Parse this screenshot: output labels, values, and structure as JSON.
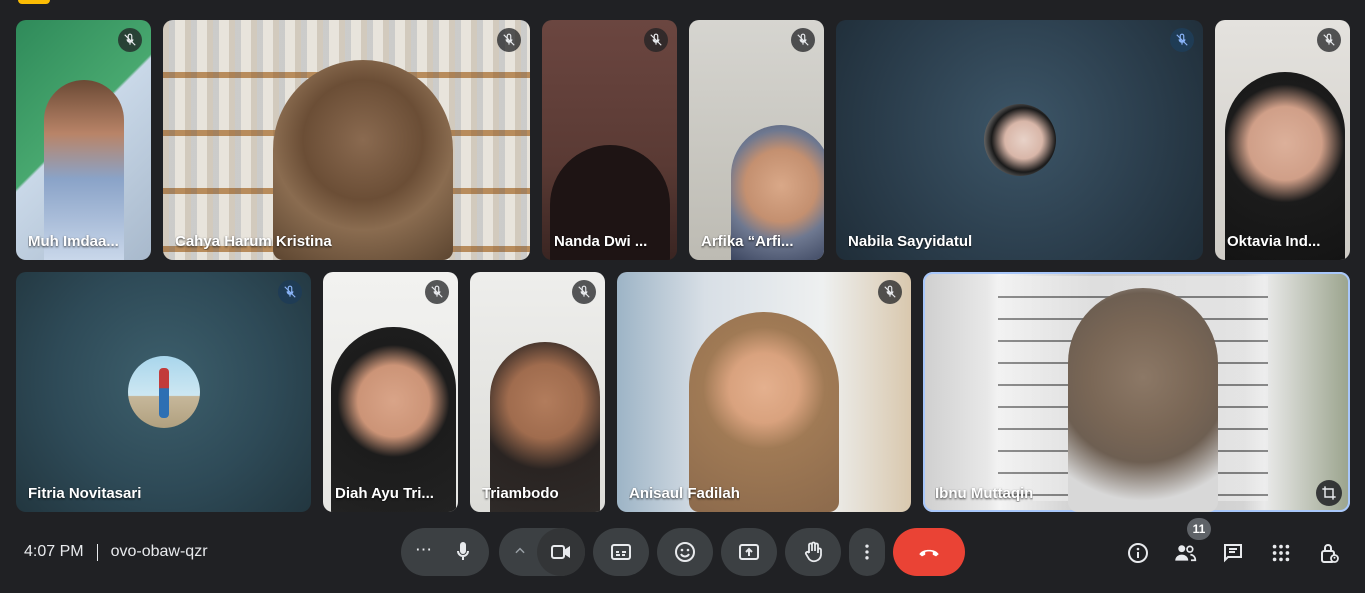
{
  "meeting": {
    "time": "4:07 PM",
    "code": "ovo-obaw-qzr"
  },
  "participants": [
    {
      "name": "Muh Imdaa...",
      "mic": "muted"
    },
    {
      "name": "Cahya Harum Kristina",
      "mic": "muted"
    },
    {
      "name": "Nanda Dwi ...",
      "mic": "muted"
    },
    {
      "name": "Arfika “Arfi...",
      "mic": "muted"
    },
    {
      "name": "Nabila Sayyidatul",
      "mic": "muted",
      "video": "off"
    },
    {
      "name": "Oktavia Ind...",
      "mic": "muted"
    },
    {
      "name": "Fitria Novitasari",
      "mic": "muted",
      "video": "off"
    },
    {
      "name": "Diah Ayu Tri...",
      "mic": "muted"
    },
    {
      "name": "Triambodo",
      "mic": "muted"
    },
    {
      "name": "Anisaul Fadilah",
      "mic": "muted"
    },
    {
      "name": "Ibnu Muttaqin",
      "mic": "on",
      "pinned": true
    }
  ],
  "controls": {
    "more_dots": "⋯",
    "participants_count": "11"
  },
  "colors": {
    "background": "#202124",
    "button": "#3c4043",
    "hangup": "#ea4335",
    "active_outline": "#a8c7fa"
  }
}
